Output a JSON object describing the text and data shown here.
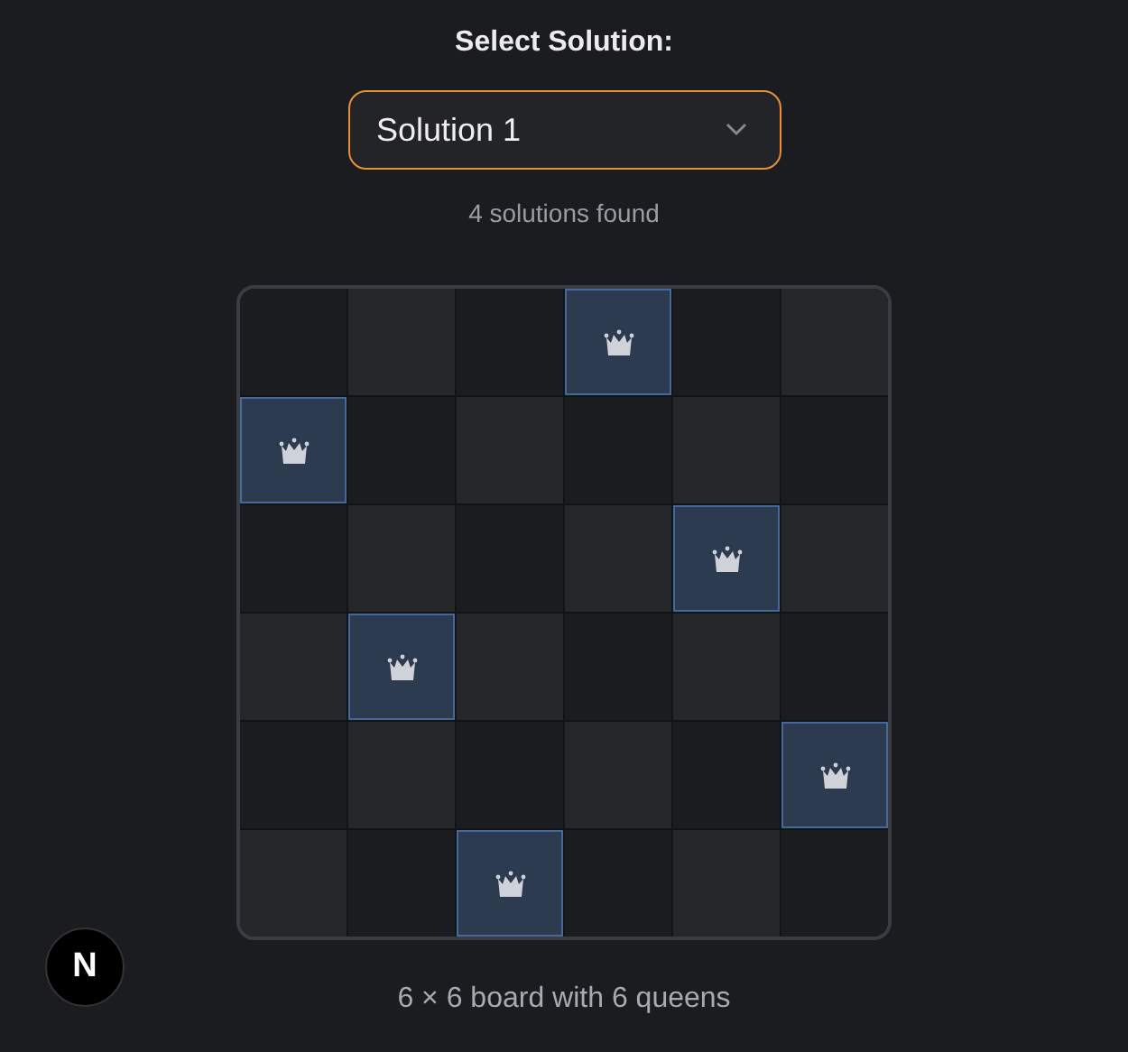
{
  "heading": "Select Solution:",
  "solution_select": {
    "value": "Solution 1"
  },
  "solutions_count": "4 solutions found",
  "board": {
    "rows": [
      {
        "cells": [
          {
            "queen": false
          },
          {
            "queen": false
          },
          {
            "queen": false
          },
          {
            "queen": true
          },
          {
            "queen": false
          },
          {
            "queen": false
          }
        ]
      },
      {
        "cells": [
          {
            "queen": true
          },
          {
            "queen": false
          },
          {
            "queen": false
          },
          {
            "queen": false
          },
          {
            "queen": false
          },
          {
            "queen": false
          }
        ]
      },
      {
        "cells": [
          {
            "queen": false
          },
          {
            "queen": false
          },
          {
            "queen": false
          },
          {
            "queen": false
          },
          {
            "queen": true
          },
          {
            "queen": false
          }
        ]
      },
      {
        "cells": [
          {
            "queen": false
          },
          {
            "queen": true
          },
          {
            "queen": false
          },
          {
            "queen": false
          },
          {
            "queen": false
          },
          {
            "queen": false
          }
        ]
      },
      {
        "cells": [
          {
            "queen": false
          },
          {
            "queen": false
          },
          {
            "queen": false
          },
          {
            "queen": false
          },
          {
            "queen": false
          },
          {
            "queen": true
          }
        ]
      },
      {
        "cells": [
          {
            "queen": false
          },
          {
            "queen": false
          },
          {
            "queen": true
          },
          {
            "queen": false
          },
          {
            "queen": false
          },
          {
            "queen": false
          }
        ]
      }
    ]
  },
  "caption": "6 × 6 board with 6 queens",
  "dev_badge": {
    "label": "N"
  }
}
